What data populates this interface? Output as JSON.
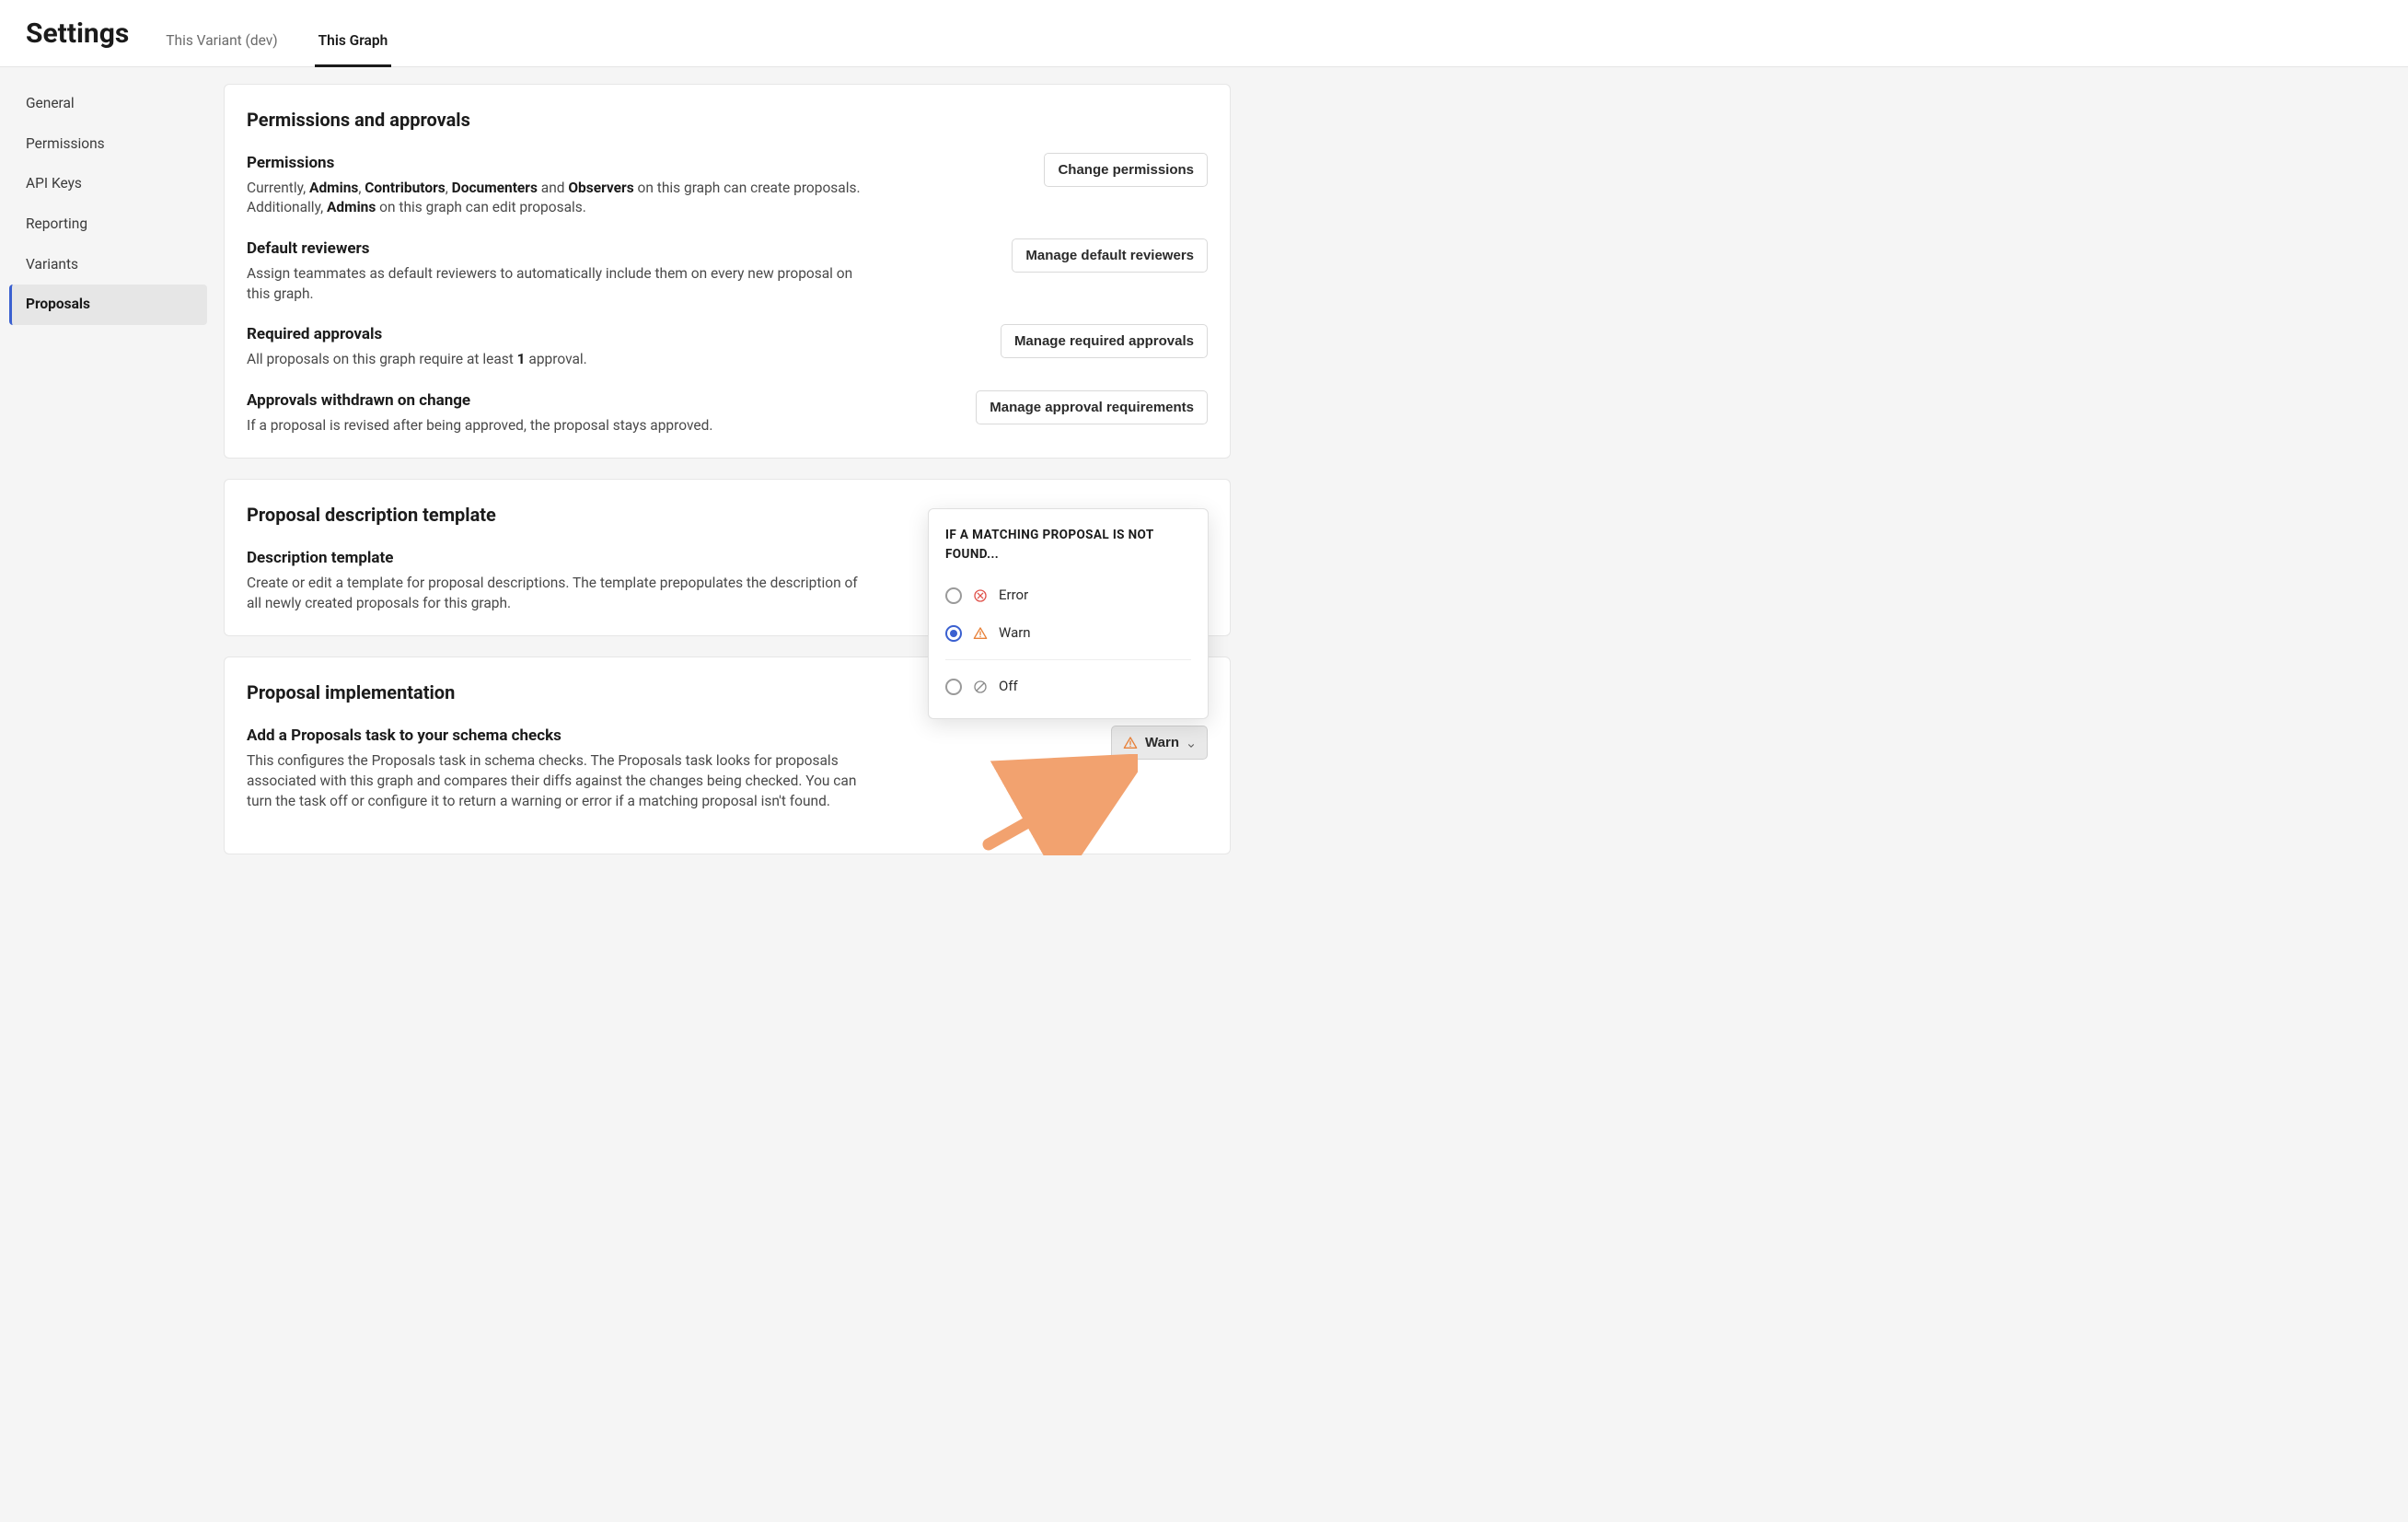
{
  "header": {
    "title": "Settings",
    "tabs": [
      {
        "label": "This Variant (dev)",
        "active": false
      },
      {
        "label": "This Graph",
        "active": true
      }
    ]
  },
  "sidebar": {
    "items": [
      {
        "label": "General",
        "active": false
      },
      {
        "label": "Permissions",
        "active": false
      },
      {
        "label": "API Keys",
        "active": false
      },
      {
        "label": "Reporting",
        "active": false
      },
      {
        "label": "Variants",
        "active": false
      },
      {
        "label": "Proposals",
        "active": true
      }
    ]
  },
  "card_permissions": {
    "title": "Permissions and approvals",
    "rows": {
      "permissions": {
        "label": "Permissions",
        "desc_prefix": "Currently, ",
        "roles_create": [
          "Admins",
          "Contributors",
          "Documenters",
          "Observers"
        ],
        "desc_mid1": " on this graph can create proposals. Additionally, ",
        "roles_edit": "Admins",
        "desc_mid2": " on this graph can edit proposals.",
        "button": "Change permissions"
      },
      "default_reviewers": {
        "label": "Default reviewers",
        "desc": "Assign teammates as default reviewers to automatically include them on every new proposal on this graph.",
        "button": "Manage default reviewers"
      },
      "required_approvals": {
        "label": "Required approvals",
        "desc_prefix": "All proposals on this graph require at least ",
        "count": "1",
        "desc_suffix": " approval.",
        "button": "Manage required approvals"
      },
      "approvals_withdrawn": {
        "label": "Approvals withdrawn on change",
        "desc": "If a proposal is revised after being approved, the proposal stays approved.",
        "button": "Manage approval requirements"
      }
    }
  },
  "card_template": {
    "title": "Proposal description template",
    "row": {
      "label": "Description template",
      "desc": "Create or edit a template for proposal descriptions. The template prepopulates the description of all newly created proposals for this graph."
    }
  },
  "card_impl": {
    "title": "Proposal implementation",
    "row": {
      "label": "Add a Proposals task to your schema checks",
      "desc": "This configures the Proposals task in schema checks. The Proposals task looks for proposals associated with this graph and compares their diffs against the changes being checked. You can turn the task off or configure it to return a warning or error if a matching proposal isn't found."
    },
    "select": {
      "current": "Warn",
      "popover_title": "IF A MATCHING PROPOSAL IS NOT FOUND...",
      "options": [
        {
          "value": "Error",
          "icon": "error-circle-icon",
          "color": "#e0534c",
          "selected": false
        },
        {
          "value": "Warn",
          "icon": "warn-triangle-icon",
          "color": "#e8823a",
          "selected": true
        },
        {
          "value": "Off",
          "icon": "off-circle-icon",
          "color": "#8a8a8a",
          "selected": false
        }
      ]
    }
  }
}
